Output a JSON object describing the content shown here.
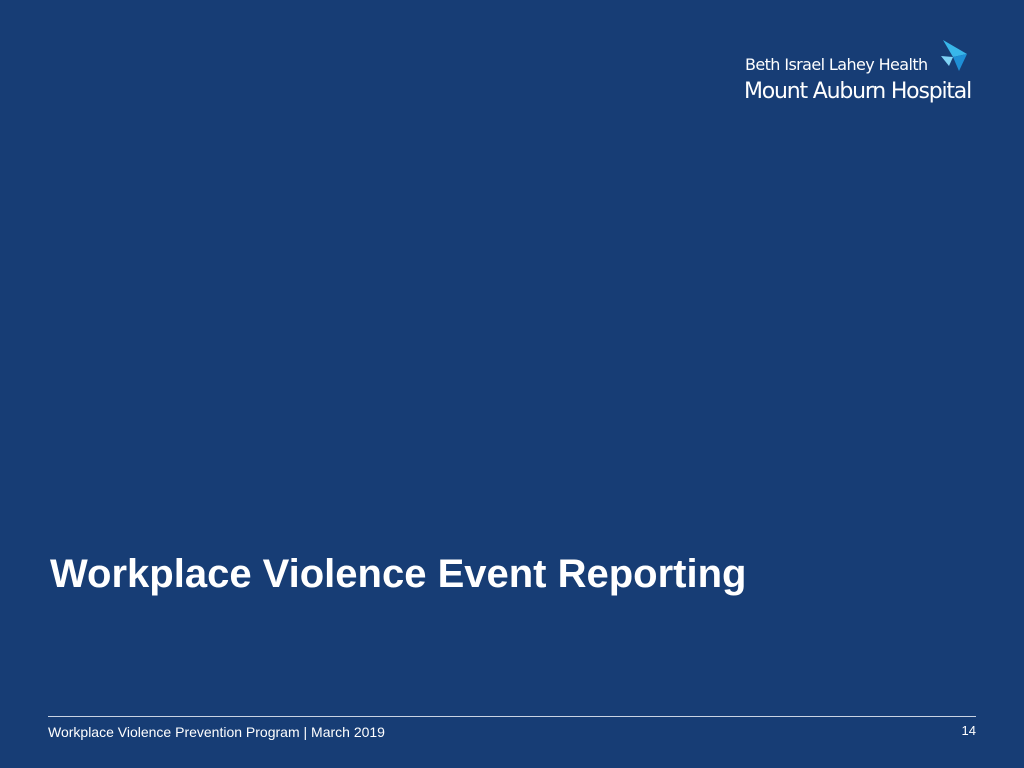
{
  "logo": {
    "parent_name": "Beth Israel Lahey Health",
    "hospital_name": "Mount Auburn Hospital",
    "mark_icon": "bird-logo-icon",
    "mark_colors": [
      "#38b7ea",
      "#1e8fd6",
      "#7fd3f5"
    ]
  },
  "slide": {
    "title": "Workplace Violence Event Reporting",
    "background_color": "#173d75"
  },
  "footer": {
    "text": "Workplace Violence Prevention Program | March 2019",
    "page_number": "14"
  }
}
